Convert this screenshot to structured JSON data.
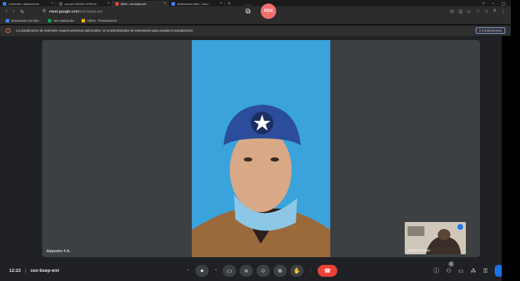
{
  "browser": {
    "tabs": [
      {
        "label": "Contenido / Aplicaciones",
        "color": "#3b82f6",
        "active": false
      },
      {
        "label": "upc-pre-202402-si730-8n...",
        "color": "#4b5563",
        "active": false
      },
      {
        "label": "Meet - cex-bsep-wxi",
        "color": "#ea4335",
        "active": true
      },
      {
        "label": "Aplicaciones Web - Docu",
        "color": "#4285f4",
        "active": false
      }
    ],
    "new_tab": "+",
    "url_domain": "meet.google.com",
    "url_path": "/cex-bsep-wxi",
    "bookmarks": [
      {
        "label": "Documento sin títul...",
        "color": "#4285f4"
      },
      {
        "label": "Ver evaluación",
        "color": "#0f9d58"
      },
      {
        "label": "Vilnes - Presentación",
        "color": "#f4b400"
      }
    ],
    "infobar_text": "La actualización de extensión requiere permisos adicionales. Ve al administrador de extensiones para aceptar la actualización.",
    "infobar_button": "Ir a Extensiones",
    "infobar_icon": "!"
  },
  "overlay": {
    "avatar_initials": "RGX"
  },
  "meet": {
    "participant_name": "Alejandro F.A.",
    "self_name": "Renato Jimenez",
    "meeting_time": "12:22",
    "separator": "|",
    "meeting_code": "cex-bsep-wxi",
    "participants_count": "3"
  },
  "icons": {
    "back": "‹",
    "forward": "›",
    "reload": "↻",
    "mic": "🎤",
    "camera": "▭",
    "captions": "CC",
    "emoji": "☺",
    "present": "⧉",
    "hand": "✋",
    "more": "⋮",
    "end": "☎",
    "info": "ⓘ",
    "people": "👥",
    "chat": "💬",
    "activities": "⚙",
    "lock": "🔒"
  }
}
